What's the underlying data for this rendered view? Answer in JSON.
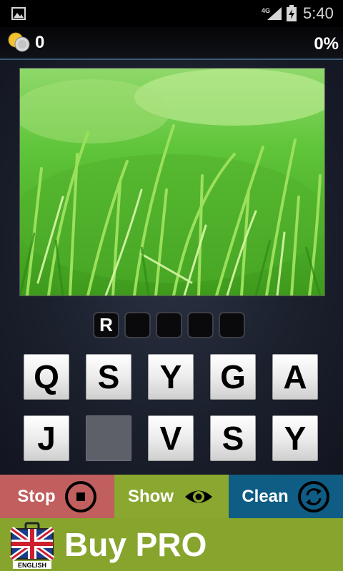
{
  "status": {
    "network": "4G",
    "time": "5:40"
  },
  "score": {
    "coins": "0",
    "progress": "0%"
  },
  "answer": {
    "slots": [
      "R",
      "",
      "",
      "",
      ""
    ]
  },
  "keyboard": {
    "row1": [
      "Q",
      "S",
      "Y",
      "G",
      "A"
    ],
    "row2": [
      "J",
      "",
      "V",
      "S",
      "Y"
    ]
  },
  "actions": {
    "stop": "Stop",
    "show": "Show",
    "clean": "Clean"
  },
  "promo": {
    "label": "Buy PRO",
    "language": "ENGLISH"
  },
  "colors": {
    "stop": "#c15e5e",
    "show": "#8aa730",
    "clean": "#0f5c84",
    "promo": "#87a42d"
  }
}
